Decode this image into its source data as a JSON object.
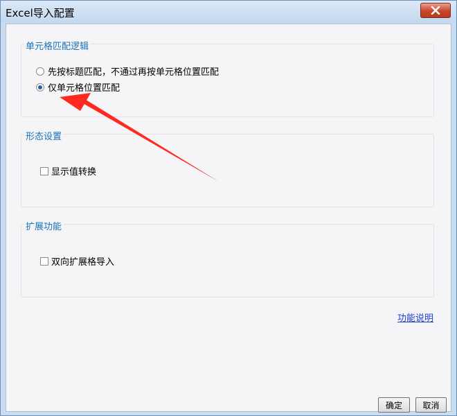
{
  "window": {
    "title": "Excel导入配置",
    "close_icon": "close-icon"
  },
  "groups": {
    "cell_match": {
      "title": "单元格匹配逻辑",
      "options": [
        {
          "label": "先按标题匹配，不通过再按单元格位置匹配",
          "checked": false
        },
        {
          "label": "仅单元格位置匹配",
          "checked": true
        }
      ]
    },
    "form": {
      "title": "形态设置",
      "checkbox_label": "显示值转换",
      "checked": false
    },
    "extension": {
      "title": "扩展功能",
      "checkbox_label": "双向扩展格导入",
      "checked": false
    }
  },
  "help_link": "功能说明",
  "buttons": {
    "ok": "确定",
    "cancel": "取消"
  },
  "annotation": {
    "color": "#ff2a1f"
  }
}
